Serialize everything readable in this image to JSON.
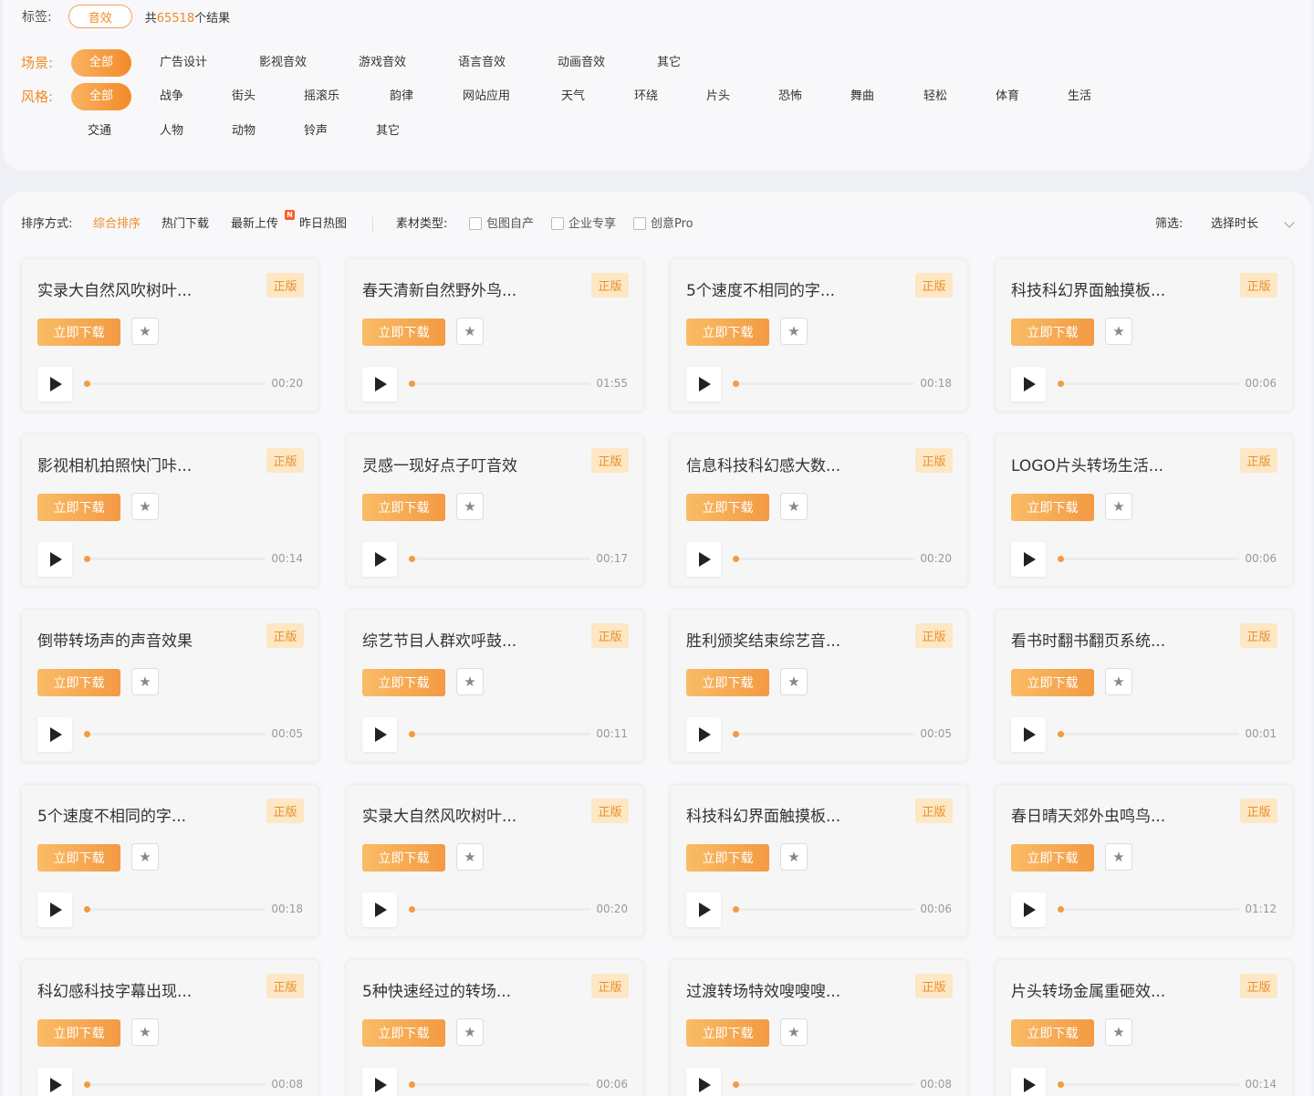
{
  "tags": {
    "label": "标签:",
    "chip": "音效",
    "result_prefix": "共",
    "result_count": "65518",
    "result_suffix": "个结果"
  },
  "scene": {
    "label": "场景:",
    "options": [
      "全部",
      "广告设计",
      "影视音效",
      "游戏音效",
      "语言音效",
      "动画音效",
      "其它"
    ]
  },
  "style": {
    "label": "风格:",
    "options": [
      "全部",
      "战争",
      "街头",
      "摇滚乐",
      "韵律",
      "网站应用",
      "天气",
      "环绕",
      "片头",
      "恐怖",
      "舞曲",
      "轻松",
      "体育",
      "生活",
      "交通",
      "人物",
      "动物",
      "铃声",
      "其它"
    ]
  },
  "sortbar": {
    "label": "排序方式:",
    "options": [
      "综合排序",
      "热门下载",
      "最新上传",
      "昨日热图"
    ],
    "new_badge": "N",
    "material_label": "素材类型:",
    "materials": [
      "包图自产",
      "企业专享",
      "创意Pro"
    ],
    "filter_label": "筛选:",
    "duration_select": "选择时长"
  },
  "card_labels": {
    "badge": "正版",
    "download": "立即下载",
    "star": "★"
  },
  "cards": [
    {
      "title": "实录大自然风吹树叶...",
      "duration": "00:20"
    },
    {
      "title": "春天清新自然野外鸟...",
      "duration": "01:55"
    },
    {
      "title": "5个速度不相同的字...",
      "duration": "00:18"
    },
    {
      "title": "科技科幻界面触摸板...",
      "duration": "00:06"
    },
    {
      "title": "影视相机拍照快门咔...",
      "duration": "00:14"
    },
    {
      "title": "灵感一现好点子叮音效",
      "duration": "00:17"
    },
    {
      "title": "信息科技科幻感大数...",
      "duration": "00:20"
    },
    {
      "title": "LOGO片头转场生活...",
      "duration": "00:06"
    },
    {
      "title": "倒带转场声的声音效果",
      "duration": "00:05"
    },
    {
      "title": "综艺节目人群欢呼鼓...",
      "duration": "00:11"
    },
    {
      "title": "胜利颁奖结束综艺音...",
      "duration": "00:05"
    },
    {
      "title": "看书时翻书翻页系统...",
      "duration": "00:01"
    },
    {
      "title": "5个速度不相同的字...",
      "duration": "00:18"
    },
    {
      "title": "实录大自然风吹树叶...",
      "duration": "00:20"
    },
    {
      "title": "科技科幻界面触摸板...",
      "duration": "00:06"
    },
    {
      "title": "春日晴天郊外虫鸣鸟...",
      "duration": "01:12"
    },
    {
      "title": "科幻感科技字幕出现...",
      "duration": "00:08"
    },
    {
      "title": "5种快速经过的转场...",
      "duration": "00:06"
    },
    {
      "title": "过渡转场特效嗖嗖嗖...",
      "duration": "00:08"
    },
    {
      "title": "片头转场金属重砸效...",
      "duration": "00:14"
    }
  ],
  "colors": {
    "accent": "#f08a24",
    "badge_bg": "#fde7c4",
    "button_gradient_start": "#f9bc66",
    "button_gradient_end": "#f39a43"
  }
}
